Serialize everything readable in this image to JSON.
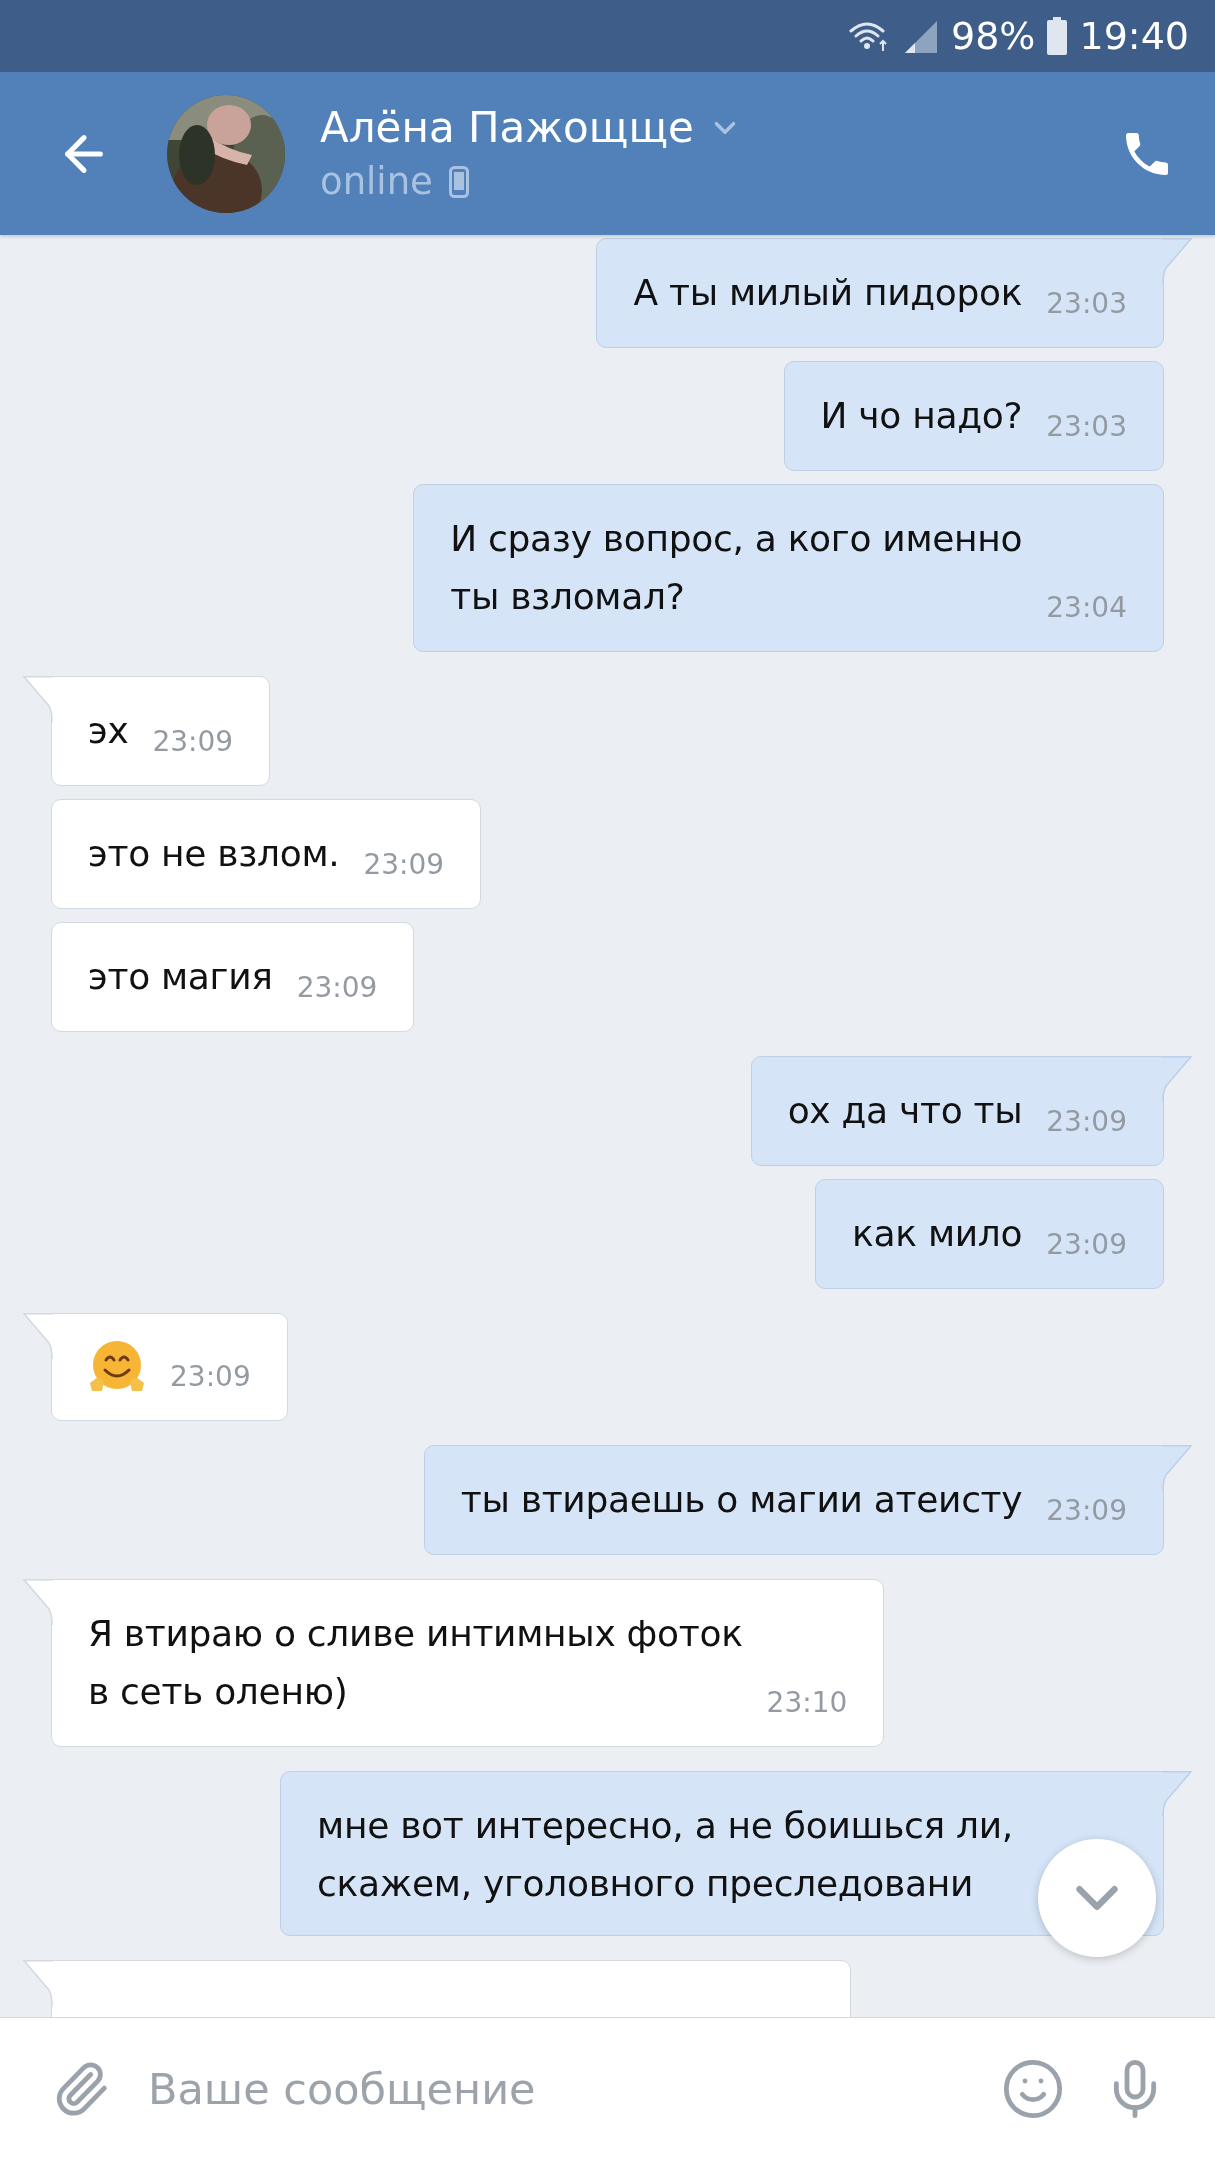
{
  "status_bar": {
    "battery": "98%",
    "time": "19:40"
  },
  "header": {
    "name": "Алёна Пажощще",
    "status": "online"
  },
  "messages": [
    {
      "outgoing": true,
      "kind": "text",
      "text": "А ты милый пидорок",
      "time": "23:03"
    },
    {
      "outgoing": true,
      "kind": "text",
      "text": "И чо надо?",
      "time": "23:03"
    },
    {
      "outgoing": true,
      "kind": "text",
      "text": "И сразу вопрос, а кого именно\nты взломал?",
      "time": "23:04"
    },
    {
      "outgoing": false,
      "kind": "text",
      "text": "эх",
      "time": "23:09"
    },
    {
      "outgoing": false,
      "kind": "text",
      "text": "это не взлом.",
      "time": "23:09"
    },
    {
      "outgoing": false,
      "kind": "text",
      "text": "это магия",
      "time": "23:09"
    },
    {
      "outgoing": true,
      "kind": "text",
      "text": "ох да что ты",
      "time": "23:09"
    },
    {
      "outgoing": true,
      "kind": "text",
      "text": "как мило",
      "time": "23:09"
    },
    {
      "outgoing": false,
      "kind": "emoji",
      "time": "23:09"
    },
    {
      "outgoing": true,
      "kind": "text",
      "text": "ты втираешь о магии атеисту",
      "time": "23:09"
    },
    {
      "outgoing": false,
      "kind": "text",
      "text": "Я втираю о сливе интимных фоток\nв сеть оленю)",
      "time": "23:10"
    },
    {
      "outgoing": true,
      "kind": "text",
      "text": "мне вот интересно, а не боишься ли,\nскажем, уголовного преследовани"
    },
    {
      "outgoing": false,
      "kind": "text"
    }
  ],
  "composer": {
    "placeholder": "Ваше сообщение"
  }
}
